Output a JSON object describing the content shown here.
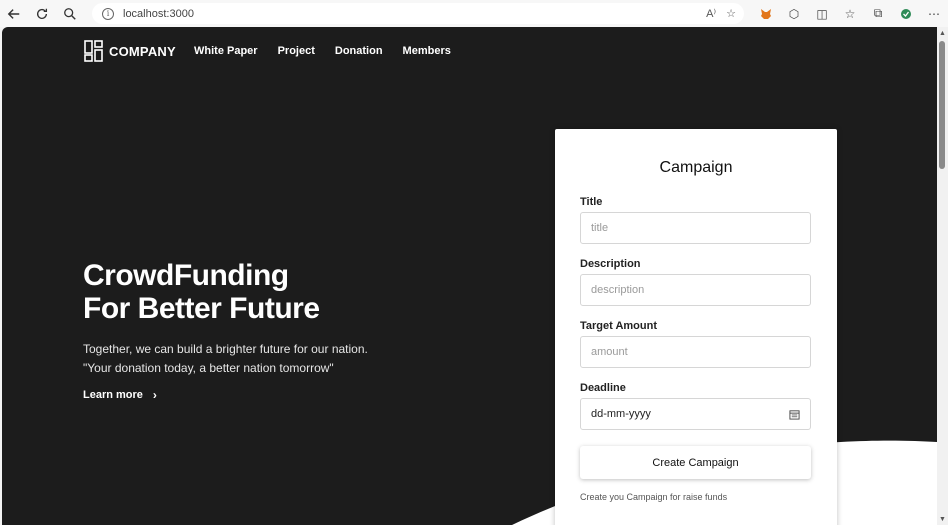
{
  "browser": {
    "url": "localhost:3000"
  },
  "nav": {
    "logo_text": "COMPANY",
    "links": [
      "White Paper",
      "Project",
      "Donation",
      "Members"
    ]
  },
  "hero": {
    "title_line1": "CrowdFunding",
    "title_line2": "For Better Future",
    "text_line1": "Together, we can build a brighter future for our nation.",
    "text_line2": "\"Your donation today, a better nation tomorrow\"",
    "learn_more": "Learn more"
  },
  "form": {
    "heading": "Campaign",
    "title_label": "Title",
    "title_placeholder": "title",
    "description_label": "Description",
    "description_placeholder": "description",
    "amount_label": "Target Amount",
    "amount_placeholder": "amount",
    "deadline_label": "Deadline",
    "deadline_value": "dd-mm-yyyy",
    "submit_label": "Create Campaign",
    "helper_text": "Create you Campaign for raise funds"
  },
  "colors": {
    "background": "#1c1c1c",
    "card": "#ffffff",
    "text_light": "#ffffff"
  }
}
